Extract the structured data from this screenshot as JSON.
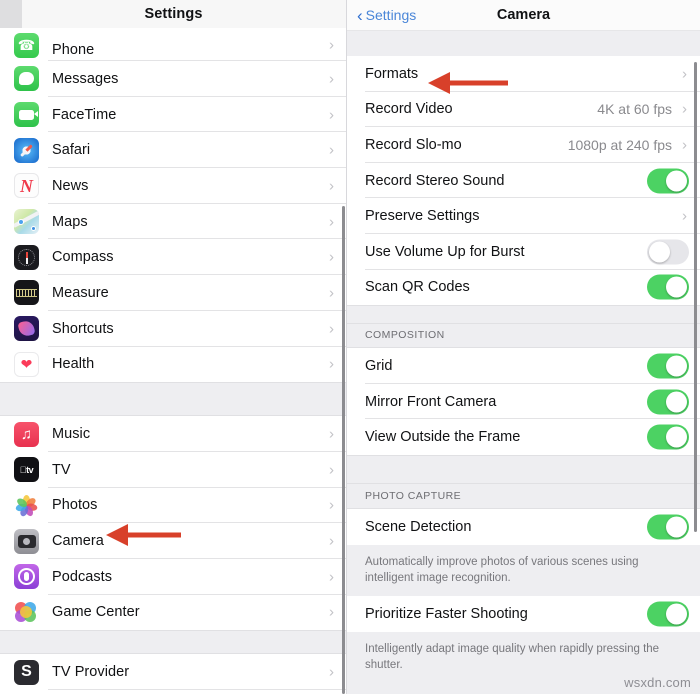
{
  "left_panel": {
    "header_title": "Settings",
    "groups": [
      {
        "items": [
          {
            "label": "Phone",
            "icon": "phone-app-icon"
          },
          {
            "label": "Messages",
            "icon": "messages-app-icon"
          },
          {
            "label": "FaceTime",
            "icon": "facetime-app-icon"
          },
          {
            "label": "Safari",
            "icon": "safari-app-icon"
          },
          {
            "label": "News",
            "icon": "news-app-icon"
          },
          {
            "label": "Maps",
            "icon": "maps-app-icon"
          },
          {
            "label": "Compass",
            "icon": "compass-app-icon"
          },
          {
            "label": "Measure",
            "icon": "measure-app-icon"
          },
          {
            "label": "Shortcuts",
            "icon": "shortcuts-app-icon"
          },
          {
            "label": "Health",
            "icon": "health-app-icon"
          }
        ]
      },
      {
        "items": [
          {
            "label": "Music",
            "icon": "music-app-icon"
          },
          {
            "label": "TV",
            "icon": "tv-app-icon"
          },
          {
            "label": "Photos",
            "icon": "photos-app-icon"
          },
          {
            "label": "Camera",
            "icon": "camera-app-icon"
          },
          {
            "label": "Podcasts",
            "icon": "podcasts-app-icon"
          },
          {
            "label": "Game Center",
            "icon": "game-center-app-icon"
          }
        ]
      },
      {
        "items": [
          {
            "label": "TV Provider",
            "icon": "tv-provider-app-icon"
          }
        ]
      }
    ],
    "chevron": "›"
  },
  "right_panel": {
    "back_label": "Settings",
    "back_chevron": "‹",
    "title": "Camera",
    "sections": [
      {
        "header": "",
        "rows": [
          {
            "label": "Formats",
            "type": "link",
            "value": "",
            "chevron": "›"
          },
          {
            "label": "Record Video",
            "type": "link",
            "value": "4K at 60 fps",
            "chevron": "›"
          },
          {
            "label": "Record Slo-mo",
            "type": "link",
            "value": "1080p at 240 fps",
            "chevron": "›"
          },
          {
            "label": "Record Stereo Sound",
            "type": "toggle",
            "on": true
          },
          {
            "label": "Preserve Settings",
            "type": "link",
            "value": "",
            "chevron": "›"
          },
          {
            "label": "Use Volume Up for Burst",
            "type": "toggle",
            "on": false
          },
          {
            "label": "Scan QR Codes",
            "type": "toggle",
            "on": true
          }
        ]
      },
      {
        "header": "COMPOSITION",
        "rows": [
          {
            "label": "Grid",
            "type": "toggle",
            "on": true
          },
          {
            "label": "Mirror Front Camera",
            "type": "toggle",
            "on": true
          },
          {
            "label": "View Outside the Frame",
            "type": "toggle",
            "on": true
          }
        ]
      },
      {
        "header": "PHOTO CAPTURE",
        "rows": [
          {
            "label": "Scene Detection",
            "type": "toggle",
            "on": true,
            "footnote": "Automatically improve photos of various scenes using intelligent image recognition."
          },
          {
            "label": "Prioritize Faster Shooting",
            "type": "toggle",
            "on": true,
            "footnote": "Intelligently adapt image quality when rapidly pressing the shutter."
          }
        ]
      }
    ]
  },
  "annotations": [
    {
      "name": "arrow-pointing-to-camera-row",
      "target": "Camera"
    },
    {
      "name": "arrow-pointing-to-formats-row",
      "target": "Formats"
    }
  ],
  "watermark": "wsxdn.com",
  "colors": {
    "accent_blue": "#4a86d8",
    "toggle_on": "#4cd263",
    "toggle_off": "#e6e6ea",
    "group_bg": "#eeeef1",
    "arrow_red": "#d8402a",
    "text_primary": "#111214",
    "text_secondary": "#8a8a8e"
  }
}
